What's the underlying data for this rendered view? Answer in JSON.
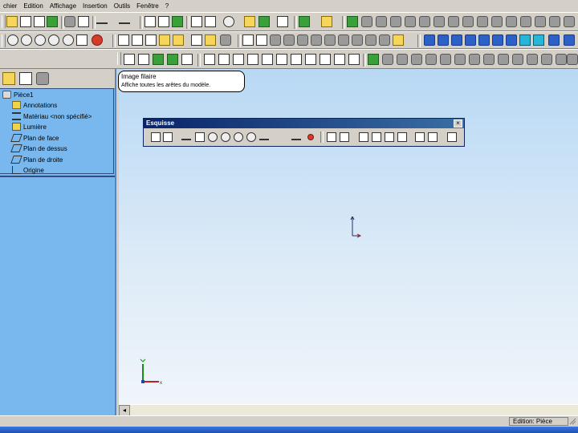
{
  "menu": [
    "chier",
    "Edition",
    "Affichage",
    "Insertion",
    "Outils",
    "Fenêtre",
    "?"
  ],
  "feature_tree": {
    "root": "Pièce1",
    "items": [
      "Annotations",
      "Matériau <non spécifié>",
      "Lumière",
      "Plan de face",
      "Plan de dessus",
      "Plan de droite",
      "Origine"
    ]
  },
  "tooltip": {
    "title": "Image filaire",
    "description": "Affiche toutes les arêtes du modèle."
  },
  "sketch_toolbar": {
    "title": "Esquisse",
    "close": "×"
  },
  "status": {
    "mode": "Edition: Pièce"
  },
  "scroll": {
    "left_arrow": "◂"
  },
  "icons": {
    "close": "close-icon",
    "size_grip": "size-grip-icon"
  }
}
